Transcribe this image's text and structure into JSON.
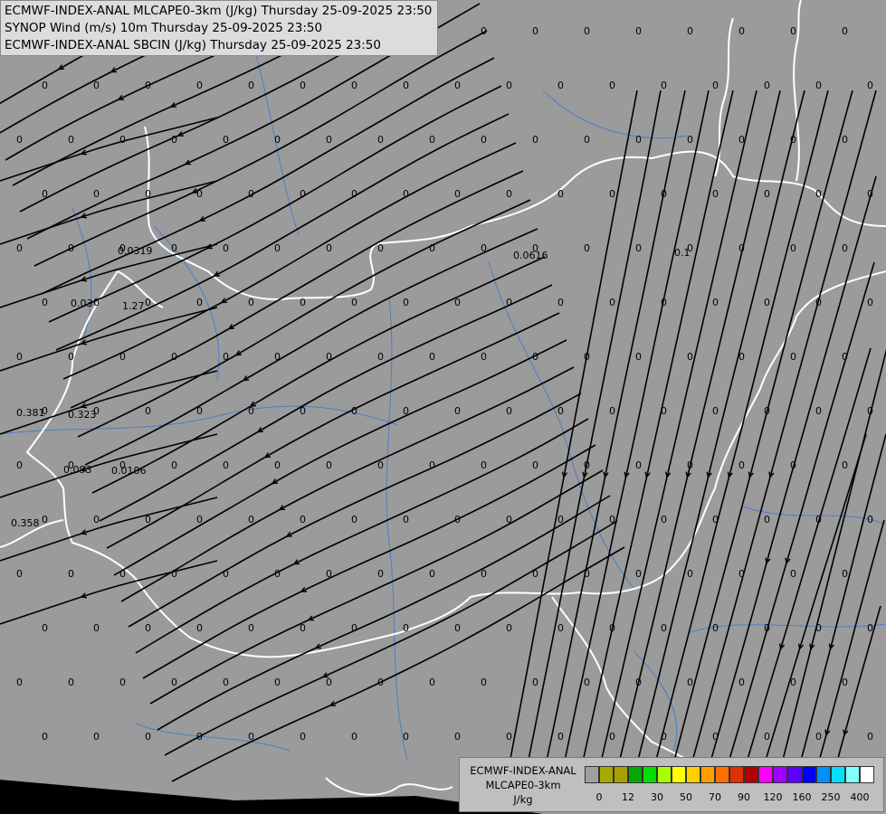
{
  "header": {
    "line1": "ECMWF-INDEX-ANAL MLCAPE0-3km (J/kg) Thursday 25-09-2025 23:50",
    "line2": "SYNOP Wind (m/s) 10m Thursday 25-09-2025 23:50",
    "line3": "ECMWF-INDEX-ANAL SBCIN (J/kg) Thursday 25-09-2025 23:50"
  },
  "legend": {
    "line1": "ECMWF-INDEX-ANAL",
    "line2": "MLCAPE0-3km",
    "line3": "J/kg",
    "colors": [
      "#a0a0a0",
      "#a8a800",
      "#a8a000",
      "#00a800",
      "#00e000",
      "#a8ff00",
      "#ffff00",
      "#ffd000",
      "#ffa000",
      "#ff7000",
      "#e03000",
      "#b00000",
      "#ff00ff",
      "#a000ff",
      "#6000ff",
      "#0000ff",
      "#0090ff",
      "#00e0ff",
      "#80ffff",
      "#ffffff"
    ],
    "ticks": [
      "0",
      "12",
      "30",
      "50",
      "70",
      "90",
      "120",
      "160",
      "250",
      "400"
    ]
  },
  "colors": {
    "land": "#9b9b9b",
    "sea": "#000000",
    "border": "#ffffff",
    "rivers": "#4a7ec8",
    "streamlines": "#000000"
  },
  "map": {
    "special_values": [
      "0.0319",
      "0.03",
      "1.27",
      "0.381",
      "0.323",
      "0.093",
      "0.0106",
      "0.358",
      "0.0616",
      "0.1"
    ]
  }
}
